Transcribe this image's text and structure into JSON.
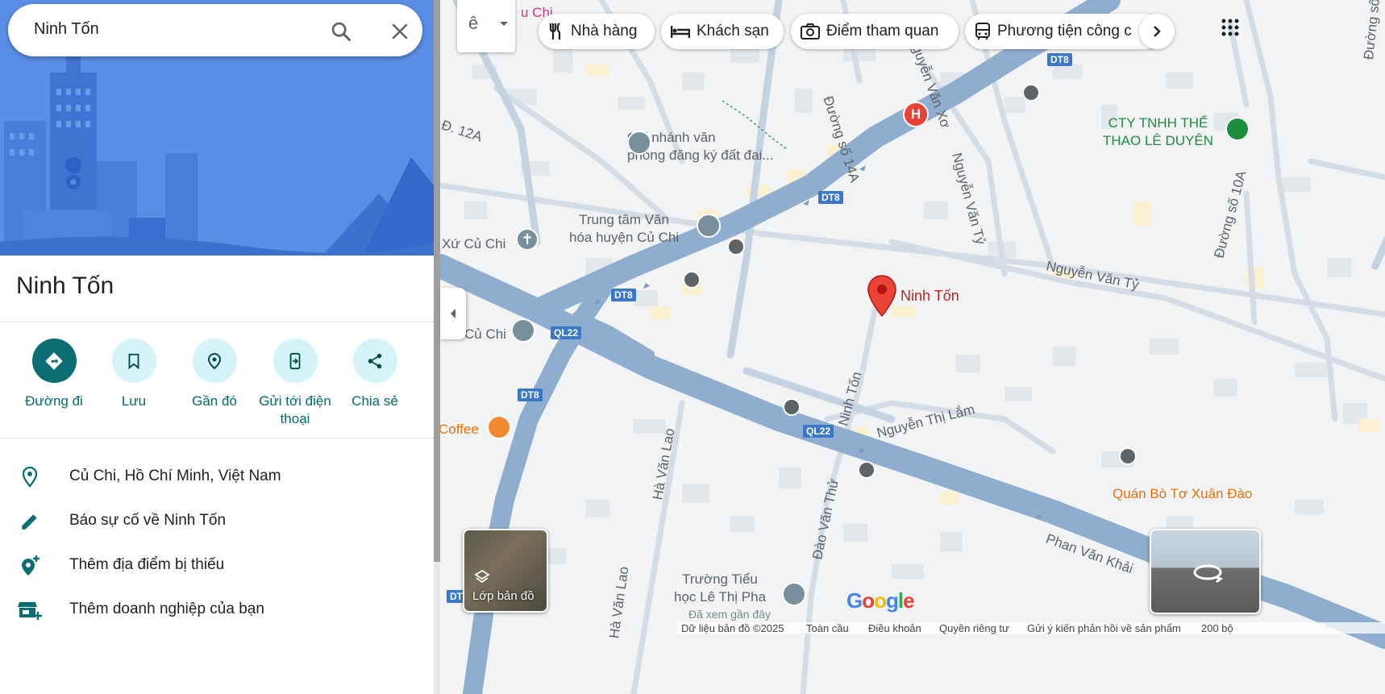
{
  "search": {
    "value": "Ninh Tốn"
  },
  "place": {
    "title": "Ninh Tốn"
  },
  "actions": [
    {
      "label": "Đường đi",
      "icon": "directions-icon"
    },
    {
      "label": "Lưu",
      "icon": "bookmark-icon"
    },
    {
      "label": "Gần đó",
      "icon": "nearby-icon"
    },
    {
      "label": "Gửi tới điện thoại",
      "icon": "send-to-phone-icon"
    },
    {
      "label": "Chia sẻ",
      "icon": "share-icon"
    }
  ],
  "info": [
    {
      "text": "Củ Chi, Hồ Chí Minh, Việt Nam",
      "icon": "location-pin-icon"
    },
    {
      "text": "Báo sự cố về Ninh Tốn",
      "icon": "pencil-icon"
    },
    {
      "text": "Thêm địa điểm bị thiếu",
      "icon": "add-location-icon"
    },
    {
      "text": "Thêm doanh nghiệp của bạn",
      "icon": "add-business-icon"
    }
  ],
  "map": {
    "lang_glyph": "ê",
    "chips": [
      "Nhà hàng",
      "Khách sạn",
      "Điểm tham quan",
      "Phương tiện công c"
    ],
    "layers_label": "Lớp bản đồ",
    "logo": "Google",
    "pois": {
      "top_partial": "u Chi",
      "chi_nhanh": "Chi nhánh văn\nphòng đăng ký đất đai...",
      "trung_tam": "Trung tâm Văn\nhóa huyện Củ Chi",
      "xu_cu_chi": "Xứ Củ Chi",
      "cu_chi": "Củ Chi",
      "coffee": "Coffee",
      "cty": "CTY TNHH THỂ\nTHAO LÊ DUYÊN",
      "quan_bo": "Quán Bò Tơ Xuân Đào",
      "truong": "Trường Tiểu\nhọc Lê Thị Pha",
      "truong_sub": "Đã xem gần đây",
      "pin": "Ninh Tốn"
    },
    "streets": {
      "d12a": "Đ. 12A",
      "duong14a": "Đường số 14A",
      "nvx": "Nguyễn Văn Xơ",
      "nvty1": "Nguyễn Văn Tỷ",
      "nvty2": "Nguyễn Văn Tỷ",
      "duong10a": "Đường số 10A",
      "ninhton": "Ninh Tốn",
      "ntl": "Nguyễn Thị Lắm",
      "hvl1": "Hà Văn Lao",
      "hvl2": "Hà Văn Lao",
      "dvt": "Đào Văn Thử",
      "pvk": "Phan Văn Khải",
      "right_edge": "Đường số"
    },
    "shields": [
      "DT8",
      "DT8",
      "DT8",
      "DT8",
      "QL22",
      "QL22",
      "DT"
    ],
    "footer": [
      "Dữ liệu bản đồ ©2025",
      "Toàn cầu",
      "Điều khoản",
      "Quyền riêng tư",
      "Gửi ý kiến phản hồi về sản phẩm",
      "200 bộ"
    ]
  },
  "colors": {
    "accent": "#0b6e73",
    "road": "#8faecf",
    "pin": "#ea4335"
  }
}
